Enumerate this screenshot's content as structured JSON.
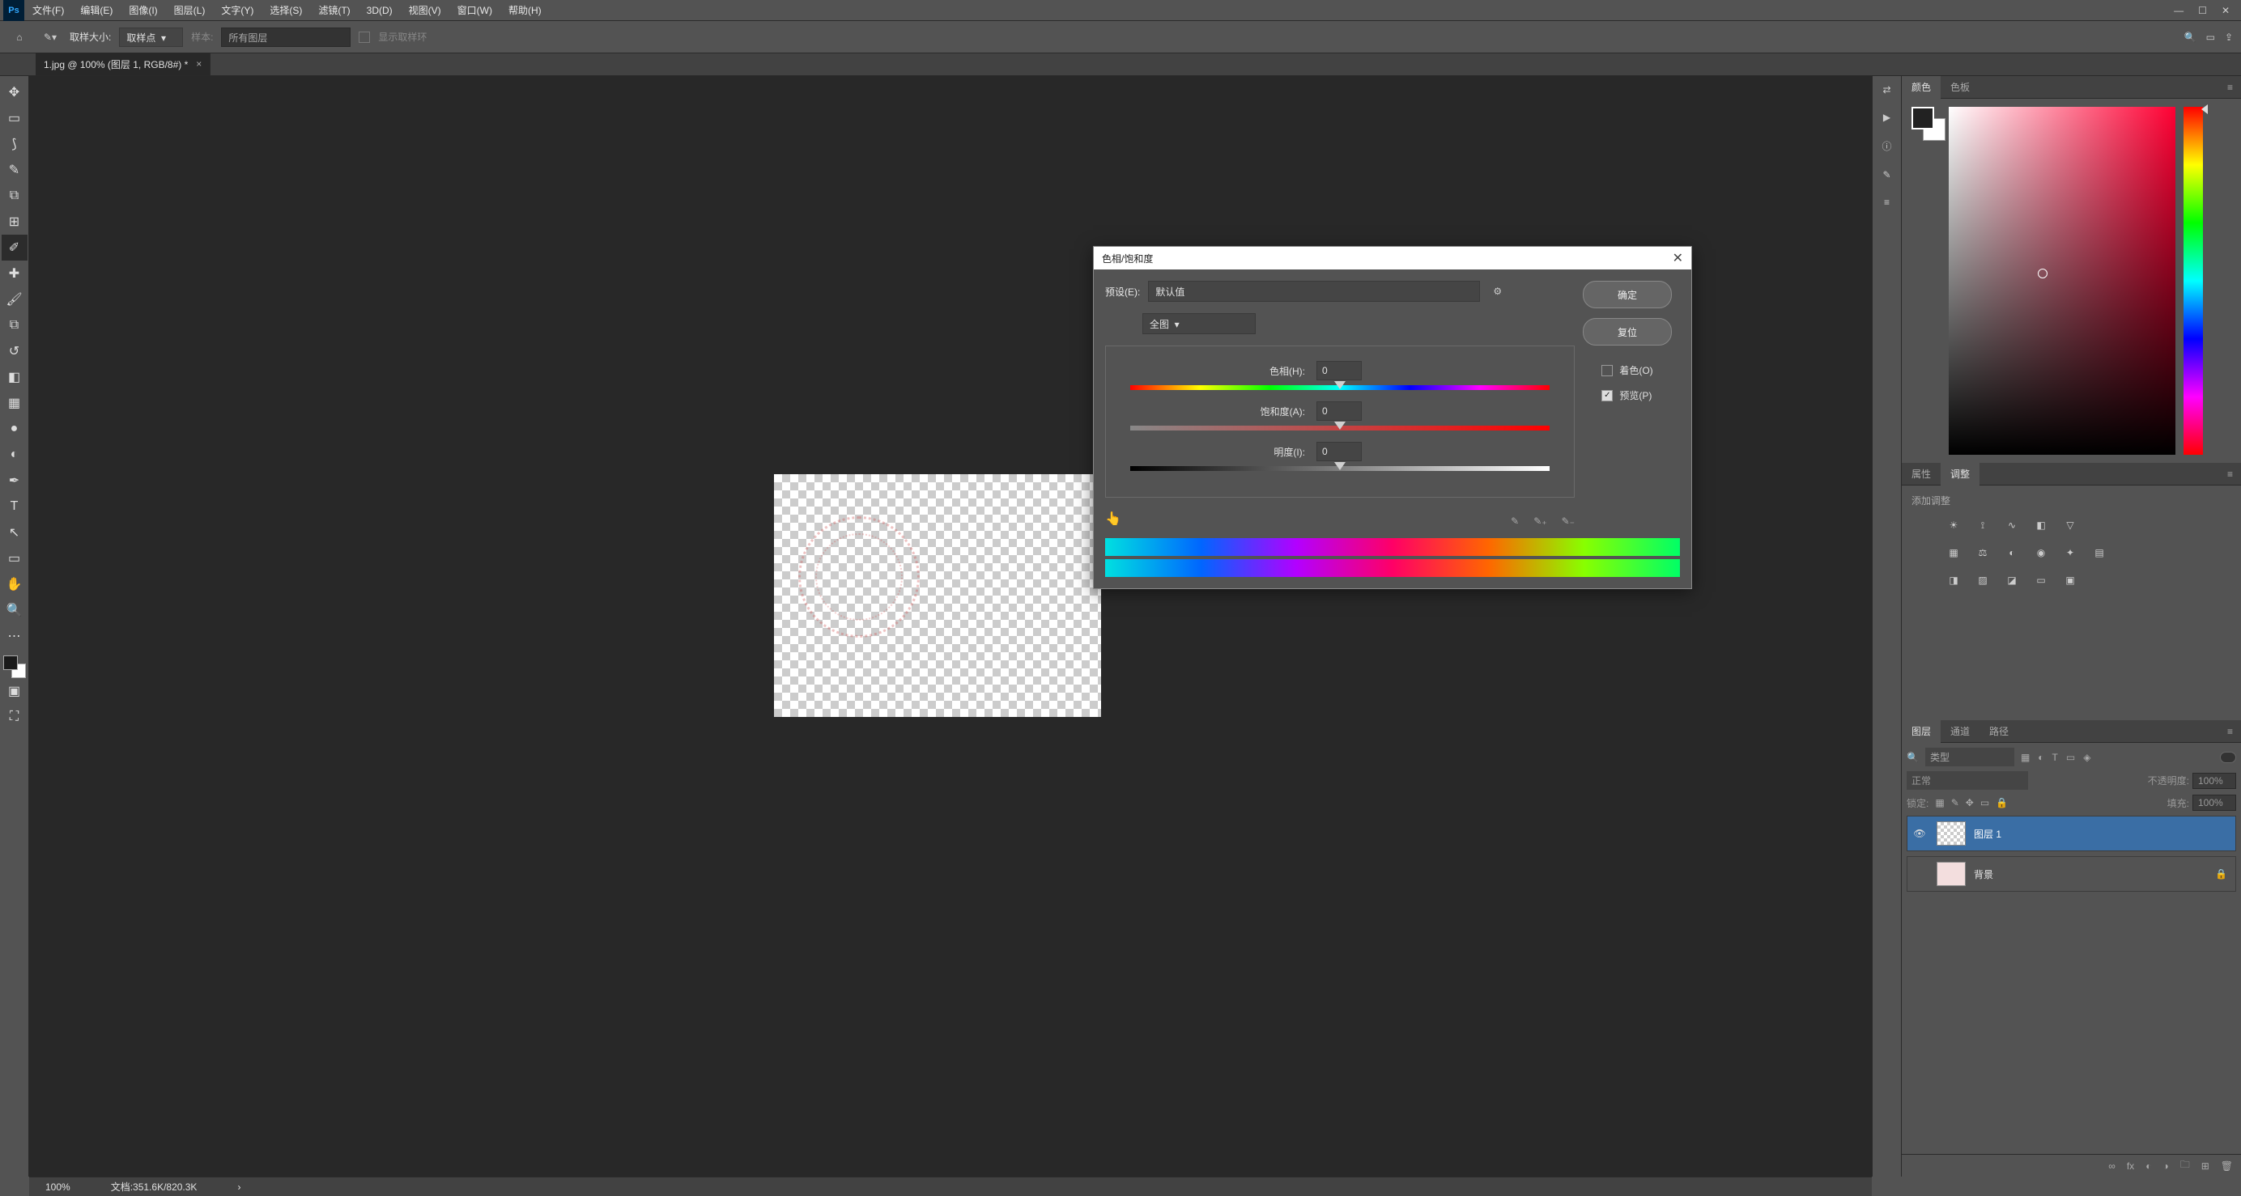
{
  "app_icon": "Ps",
  "menu": [
    "文件(F)",
    "编辑(E)",
    "图像(I)",
    "图层(L)",
    "文字(Y)",
    "选择(S)",
    "滤镜(T)",
    "3D(D)",
    "视图(V)",
    "窗口(W)",
    "帮助(H)"
  ],
  "options_bar": {
    "sample_size_label": "取样大小:",
    "sample_size_value": "取样点",
    "sample_label": "样本:",
    "sample_value": "所有图层",
    "show_ring_label": "显示取样环"
  },
  "document_tab": {
    "title": "1.jpg @ 100% (图层 1, RGB/8#) *"
  },
  "status_bar": {
    "zoom": "100%",
    "doc_info": "文档:351.6K/820.3K"
  },
  "dialog": {
    "title": "色相/饱和度",
    "preset_label": "预设(E):",
    "preset_value": "默认值",
    "channel_value": "全图",
    "hue_label": "色相(H):",
    "hue_value": "0",
    "sat_label": "饱和度(A):",
    "sat_value": "0",
    "light_label": "明度(I):",
    "light_value": "0",
    "colorize_label": "着色(O)",
    "preview_label": "预览(P)",
    "ok": "确定",
    "reset": "复位"
  },
  "panels": {
    "color_tab": "颜色",
    "swatches_tab": "色板",
    "properties_tab": "属性",
    "adjustments_tab": "调整",
    "add_adjustment_label": "添加调整",
    "layers_tab": "图层",
    "channels_tab": "通道",
    "paths_tab": "路径"
  },
  "layers": {
    "filter_kind": "类型",
    "blend_mode": "正常",
    "opacity_label": "不透明度:",
    "opacity_value": "100%",
    "lock_label": "锁定:",
    "fill_label": "填充:",
    "fill_value": "100%",
    "items": [
      {
        "name": "图层 1"
      },
      {
        "name": "背景"
      }
    ]
  }
}
